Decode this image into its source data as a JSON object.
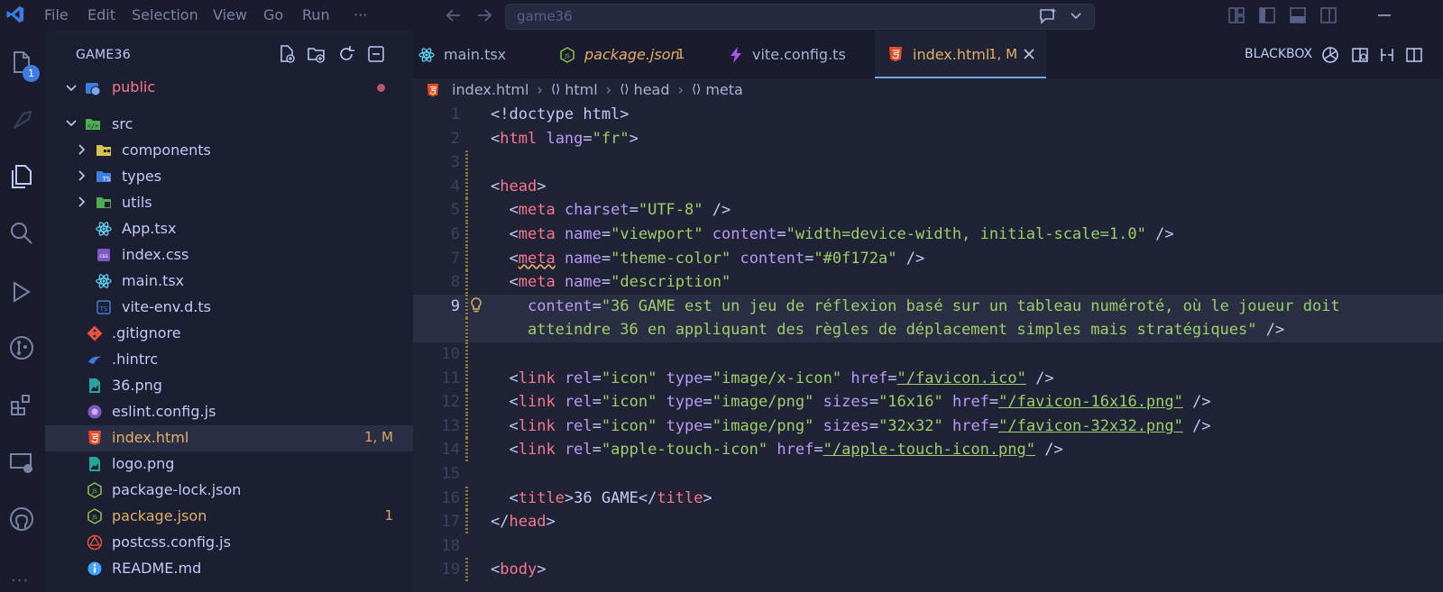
{
  "titlebar": {
    "menu": [
      "File",
      "Edit",
      "Selection",
      "View",
      "Go",
      "Run",
      "···"
    ],
    "search_text": "game36"
  },
  "activitybar": {
    "explorer_badge": "1"
  },
  "sidebar": {
    "title": "GAME36",
    "items": [
      {
        "label": "public",
        "color": "#f7768e",
        "depth": 0,
        "folder": true,
        "open": true,
        "dot": true
      },
      {
        "label": "src",
        "depth": 0,
        "folder": true,
        "open": true
      },
      {
        "label": "components",
        "depth": 1,
        "folder": true,
        "open": false
      },
      {
        "label": "types",
        "depth": 1,
        "folder": true,
        "open": false
      },
      {
        "label": "utils",
        "depth": 1,
        "folder": true,
        "open": false
      },
      {
        "label": "App.tsx",
        "depth": 1
      },
      {
        "label": "index.css",
        "depth": 1
      },
      {
        "label": "main.tsx",
        "depth": 1
      },
      {
        "label": "vite-env.d.ts",
        "depth": 1
      },
      {
        "label": ".gitignore",
        "depth": 0
      },
      {
        "label": ".hintrc",
        "depth": 0
      },
      {
        "label": "36.png",
        "depth": 0
      },
      {
        "label": "eslint.config.js",
        "depth": 0
      },
      {
        "label": "index.html",
        "depth": 0,
        "badge": "1, M",
        "selected": true,
        "color": "#e0af68"
      },
      {
        "label": "logo.png",
        "depth": 0
      },
      {
        "label": "package-lock.json",
        "depth": 0
      },
      {
        "label": "package.json",
        "depth": 0,
        "badge": "1",
        "color": "#e0af68"
      },
      {
        "label": "postcss.config.js",
        "depth": 0
      },
      {
        "label": "README.md",
        "depth": 0
      }
    ]
  },
  "tabs": [
    {
      "label": "main.tsx"
    },
    {
      "label": "package.json",
      "badge": "1"
    },
    {
      "label": "vite.config.ts"
    },
    {
      "label": "index.html",
      "badge": "1, M",
      "active": true
    }
  ],
  "toolbar": {
    "blackbox": "BLACKBOX"
  },
  "breadcrumb": [
    "index.html",
    "html",
    "head",
    "meta"
  ],
  "code": {
    "lines": [
      {
        "n": "1",
        "parts": [
          [
            "br",
            "<!doctype html>"
          ]
        ]
      },
      {
        "n": "2",
        "parts": [
          [
            "br",
            "<"
          ],
          [
            "tag",
            "html"
          ],
          [
            "plain",
            " "
          ],
          [
            "attr",
            "lang"
          ],
          [
            "plain",
            "="
          ],
          [
            "str",
            "\"fr\""
          ],
          [
            "br",
            ">"
          ]
        ]
      },
      {
        "n": "3",
        "parts": []
      },
      {
        "n": "4",
        "parts": [
          [
            "br",
            "<"
          ],
          [
            "tag",
            "head"
          ],
          [
            "br",
            ">"
          ]
        ]
      },
      {
        "n": "5",
        "parts": [
          [
            "plain",
            "  "
          ],
          [
            "br",
            "<"
          ],
          [
            "tag",
            "meta"
          ],
          [
            "plain",
            " "
          ],
          [
            "attr",
            "charset"
          ],
          [
            "plain",
            "="
          ],
          [
            "str",
            "\"UTF-8\""
          ],
          [
            "plain",
            " "
          ],
          [
            "br",
            "/>"
          ]
        ]
      },
      {
        "n": "6",
        "parts": [
          [
            "plain",
            "  "
          ],
          [
            "br",
            "<"
          ],
          [
            "tag",
            "meta"
          ],
          [
            "plain",
            " "
          ],
          [
            "attr",
            "name"
          ],
          [
            "plain",
            "="
          ],
          [
            "str",
            "\"viewport\""
          ],
          [
            "plain",
            " "
          ],
          [
            "attr",
            "content"
          ],
          [
            "plain",
            "="
          ],
          [
            "str",
            "\"width=device-width, initial-scale=1.0\""
          ],
          [
            "plain",
            " "
          ],
          [
            "br",
            "/>"
          ]
        ]
      },
      {
        "n": "7",
        "parts": [
          [
            "plain",
            "  "
          ],
          [
            "br",
            "<"
          ],
          [
            "tag",
            "meta"
          ],
          [
            "plain",
            " "
          ],
          [
            "attr",
            "name"
          ],
          [
            "plain",
            "="
          ],
          [
            "str",
            "\"theme-color\""
          ],
          [
            "plain",
            " "
          ],
          [
            "attr",
            "content"
          ],
          [
            "plain",
            "="
          ],
          [
            "str",
            "\"#0f172a\""
          ],
          [
            "plain",
            " "
          ],
          [
            "br",
            "/>"
          ]
        ]
      },
      {
        "n": "8",
        "parts": [
          [
            "plain",
            "  "
          ],
          [
            "br",
            "<"
          ],
          [
            "tag",
            "meta"
          ],
          [
            "plain",
            " "
          ],
          [
            "attr",
            "name"
          ],
          [
            "plain",
            "="
          ],
          [
            "str",
            "\"description\""
          ]
        ]
      },
      {
        "n": "9",
        "parts": [
          [
            "plain",
            "    "
          ],
          [
            "attr",
            "content"
          ],
          [
            "plain",
            "="
          ],
          [
            "str",
            "\"36 GAME est un jeu de réflexion basé sur un tableau numéroté, où le joueur doit"
          ]
        ]
      },
      {
        "n": "",
        "parts": [
          [
            "str",
            "    atteindre 36 en appliquant des règles de déplacement simples mais stratégiques\""
          ],
          [
            "plain",
            " "
          ],
          [
            "br",
            "/>"
          ]
        ]
      },
      {
        "n": "10",
        "parts": []
      },
      {
        "n": "11",
        "parts": [
          [
            "plain",
            "  "
          ],
          [
            "br",
            "<"
          ],
          [
            "tag",
            "link"
          ],
          [
            "plain",
            " "
          ],
          [
            "attr",
            "rel"
          ],
          [
            "plain",
            "="
          ],
          [
            "str",
            "\"icon\""
          ],
          [
            "plain",
            " "
          ],
          [
            "attr",
            "type"
          ],
          [
            "plain",
            "="
          ],
          [
            "str",
            "\"image/x-icon\""
          ],
          [
            "plain",
            " "
          ],
          [
            "attr",
            "href"
          ],
          [
            "plain",
            "="
          ],
          [
            "str",
            "\"/favicon.ico\""
          ],
          [
            "plain",
            " "
          ],
          [
            "br",
            "/>"
          ]
        ]
      },
      {
        "n": "12",
        "parts": [
          [
            "plain",
            "  "
          ],
          [
            "br",
            "<"
          ],
          [
            "tag",
            "link"
          ],
          [
            "plain",
            " "
          ],
          [
            "attr",
            "rel"
          ],
          [
            "plain",
            "="
          ],
          [
            "str",
            "\"icon\""
          ],
          [
            "plain",
            " "
          ],
          [
            "attr",
            "type"
          ],
          [
            "plain",
            "="
          ],
          [
            "str",
            "\"image/png\""
          ],
          [
            "plain",
            " "
          ],
          [
            "attr",
            "sizes"
          ],
          [
            "plain",
            "="
          ],
          [
            "str",
            "\"16x16\""
          ],
          [
            "plain",
            " "
          ],
          [
            "attr",
            "href"
          ],
          [
            "plain",
            "="
          ],
          [
            "str",
            "\"/favicon-16x16.png\""
          ],
          [
            "plain",
            " "
          ],
          [
            "br",
            "/>"
          ]
        ]
      },
      {
        "n": "13",
        "parts": [
          [
            "plain",
            "  "
          ],
          [
            "br",
            "<"
          ],
          [
            "tag",
            "link"
          ],
          [
            "plain",
            " "
          ],
          [
            "attr",
            "rel"
          ],
          [
            "plain",
            "="
          ],
          [
            "str",
            "\"icon\""
          ],
          [
            "plain",
            " "
          ],
          [
            "attr",
            "type"
          ],
          [
            "plain",
            "="
          ],
          [
            "str",
            "\"image/png\""
          ],
          [
            "plain",
            " "
          ],
          [
            "attr",
            "sizes"
          ],
          [
            "plain",
            "="
          ],
          [
            "str",
            "\"32x32\""
          ],
          [
            "plain",
            " "
          ],
          [
            "attr",
            "href"
          ],
          [
            "plain",
            "="
          ],
          [
            "str",
            "\"/favicon-32x32.png\""
          ],
          [
            "plain",
            " "
          ],
          [
            "br",
            "/>"
          ]
        ]
      },
      {
        "n": "14",
        "parts": [
          [
            "plain",
            "  "
          ],
          [
            "br",
            "<"
          ],
          [
            "tag",
            "link"
          ],
          [
            "plain",
            " "
          ],
          [
            "attr",
            "rel"
          ],
          [
            "plain",
            "="
          ],
          [
            "str",
            "\"apple-touch-icon\""
          ],
          [
            "plain",
            " "
          ],
          [
            "attr",
            "href"
          ],
          [
            "plain",
            "="
          ],
          [
            "str",
            "\"/apple-touch-icon.png\""
          ],
          [
            "plain",
            " "
          ],
          [
            "br",
            "/>"
          ]
        ]
      },
      {
        "n": "15",
        "parts": []
      },
      {
        "n": "16",
        "parts": [
          [
            "plain",
            "  "
          ],
          [
            "br",
            "<"
          ],
          [
            "tag",
            "title"
          ],
          [
            "br",
            ">"
          ],
          [
            "plain",
            "36 GAME"
          ],
          [
            "br",
            "</"
          ],
          [
            "tag",
            "title"
          ],
          [
            "br",
            ">"
          ]
        ]
      },
      {
        "n": "17",
        "parts": [
          [
            "br",
            "</"
          ],
          [
            "tag",
            "head"
          ],
          [
            "br",
            ">"
          ]
        ]
      },
      {
        "n": "18",
        "parts": []
      },
      {
        "n": "19",
        "parts": [
          [
            "br",
            "<"
          ],
          [
            "tag",
            "body"
          ],
          [
            "br",
            ">"
          ]
        ]
      }
    ],
    "current_line": "9"
  }
}
